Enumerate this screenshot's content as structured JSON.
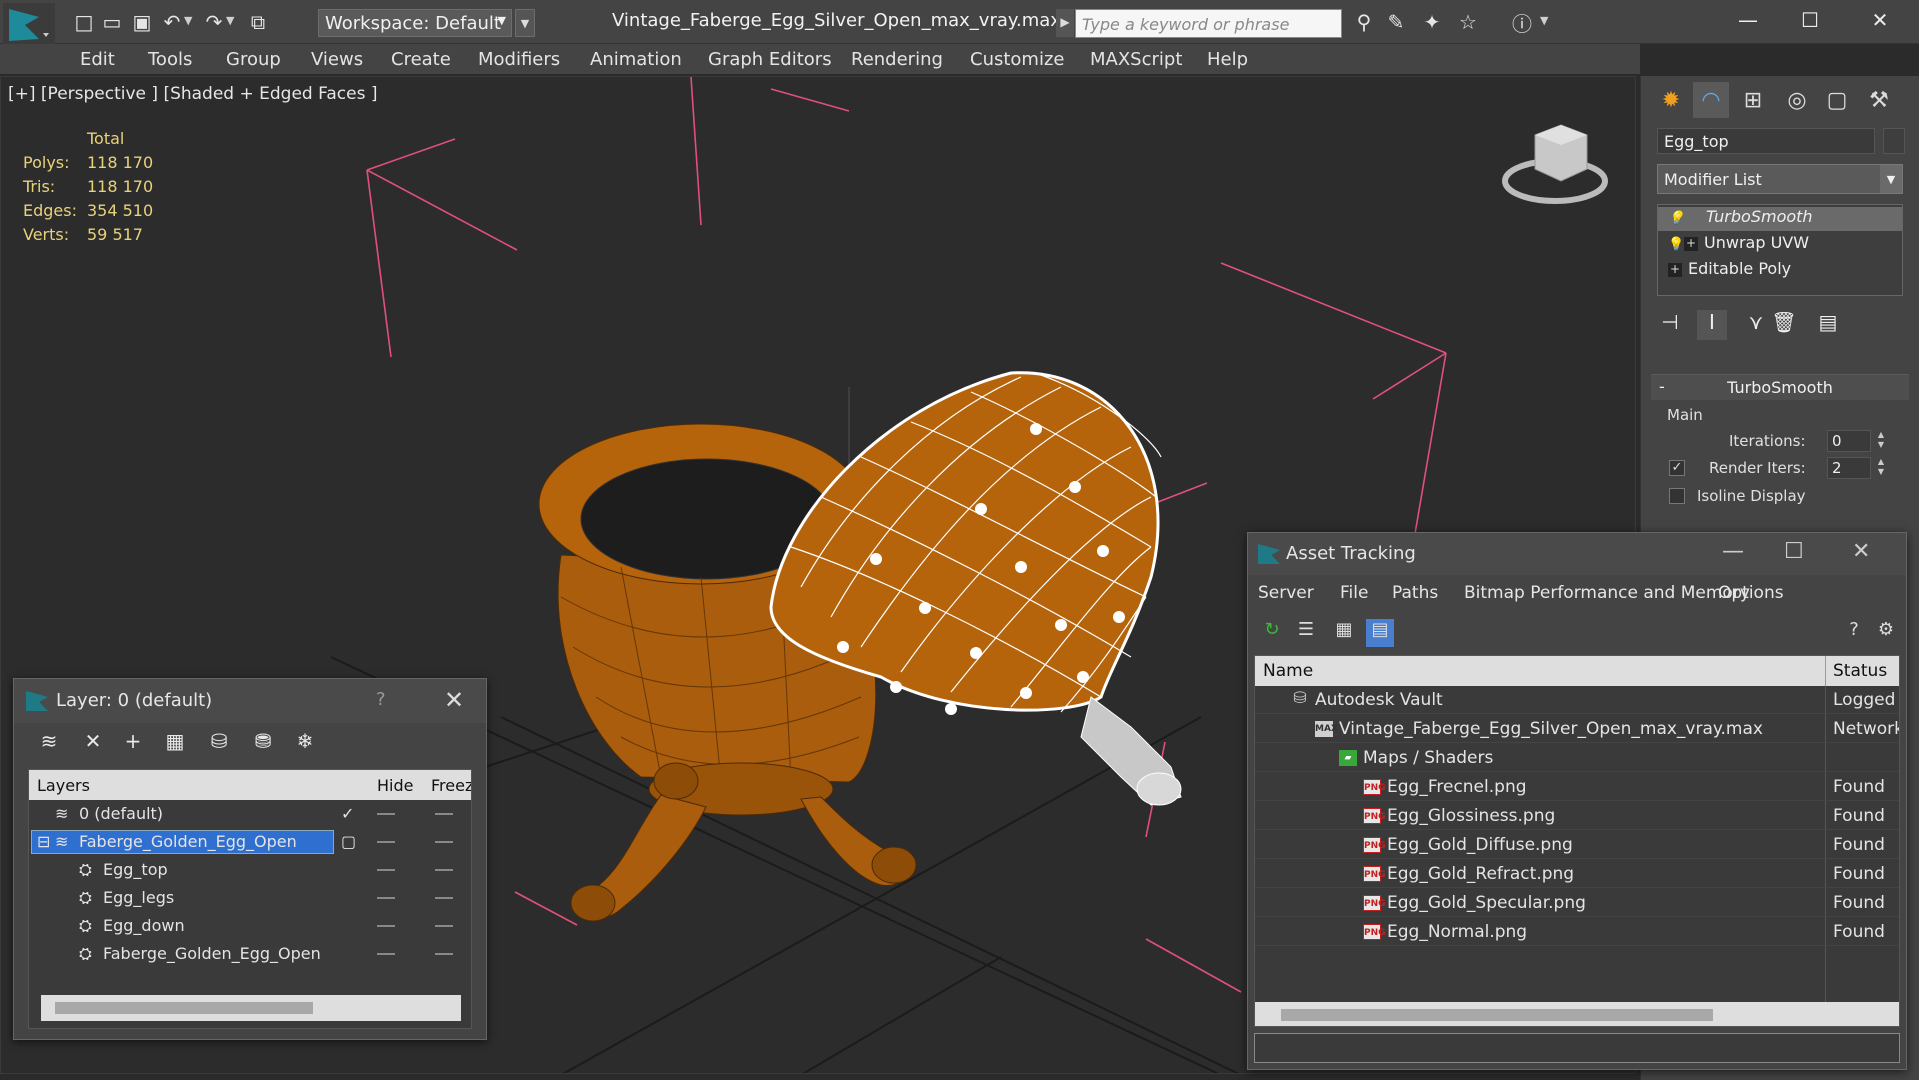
{
  "titlebar": {
    "workspace_label": "Workspace: Default",
    "document_title": "Vintage_Faberge_Egg_Silver_Open_max_vray.max",
    "search_placeholder": "Type a keyword or phrase"
  },
  "menu": [
    "Edit",
    "Tools",
    "Group",
    "Views",
    "Create",
    "Modifiers",
    "Animation",
    "Graph Editors",
    "Rendering",
    "Customize",
    "MAXScript",
    "Help"
  ],
  "viewport": {
    "label": "[+] [Perspective ] [Shaded + Edged Faces ]",
    "stats_header": "Total",
    "stats": [
      {
        "k": "Polys:",
        "v": "118 170"
      },
      {
        "k": "Tris:",
        "v": "118 170"
      },
      {
        "k": "Edges:",
        "v": "354 510"
      },
      {
        "k": "Verts:",
        "v": "59 517"
      }
    ]
  },
  "command_panel": {
    "object_name": "Egg_top",
    "modifier_list": "Modifier List",
    "stack": [
      "TurboSmooth",
      "Unwrap UVW",
      "Editable Poly"
    ],
    "rollout_title": "TurboSmooth",
    "group_main": "Main",
    "iterations_label": "Iterations:",
    "iterations_value": "0",
    "render_iters_label": "Render Iters:",
    "render_iters_value": "2",
    "isoline_label": "Isoline Display"
  },
  "layer_dialog": {
    "title": "Layer: 0 (default)",
    "help": "?",
    "col_layers": "Layers",
    "col_hide": "Hide",
    "col_freeze": "Freez",
    "rows": [
      {
        "name": "0 (default)"
      },
      {
        "name": "Faberge_Golden_Egg_Open"
      },
      {
        "name": "Egg_top"
      },
      {
        "name": "Egg_legs"
      },
      {
        "name": "Egg_down"
      },
      {
        "name": "Faberge_Golden_Egg_Open"
      }
    ]
  },
  "asset_dialog": {
    "title": "Asset Tracking",
    "menu": [
      "Server",
      "File",
      "Paths",
      "Bitmap Performance and Memory",
      "Options"
    ],
    "col_name": "Name",
    "col_status": "Status",
    "rows": [
      {
        "name": "Autodesk Vault",
        "status": "Logged O"
      },
      {
        "name": "Vintage_Faberge_Egg_Silver_Open_max_vray.max",
        "status": "Network"
      },
      {
        "name": "Maps / Shaders",
        "status": ""
      },
      {
        "name": "Egg_Frecnel.png",
        "status": "Found"
      },
      {
        "name": "Egg_Glossiness.png",
        "status": "Found"
      },
      {
        "name": "Egg_Gold_Diffuse.png",
        "status": "Found"
      },
      {
        "name": "Egg_Gold_Refract.png",
        "status": "Found"
      },
      {
        "name": "Egg_Gold_Specular.png",
        "status": "Found"
      },
      {
        "name": "Egg_Normal.png",
        "status": "Found"
      }
    ]
  },
  "colors": {
    "accent_blue": "#2f6fd0",
    "gold": "#b5640c",
    "stats_yellow": "#e8d27a",
    "gizmo_pink": "#e0507a"
  }
}
